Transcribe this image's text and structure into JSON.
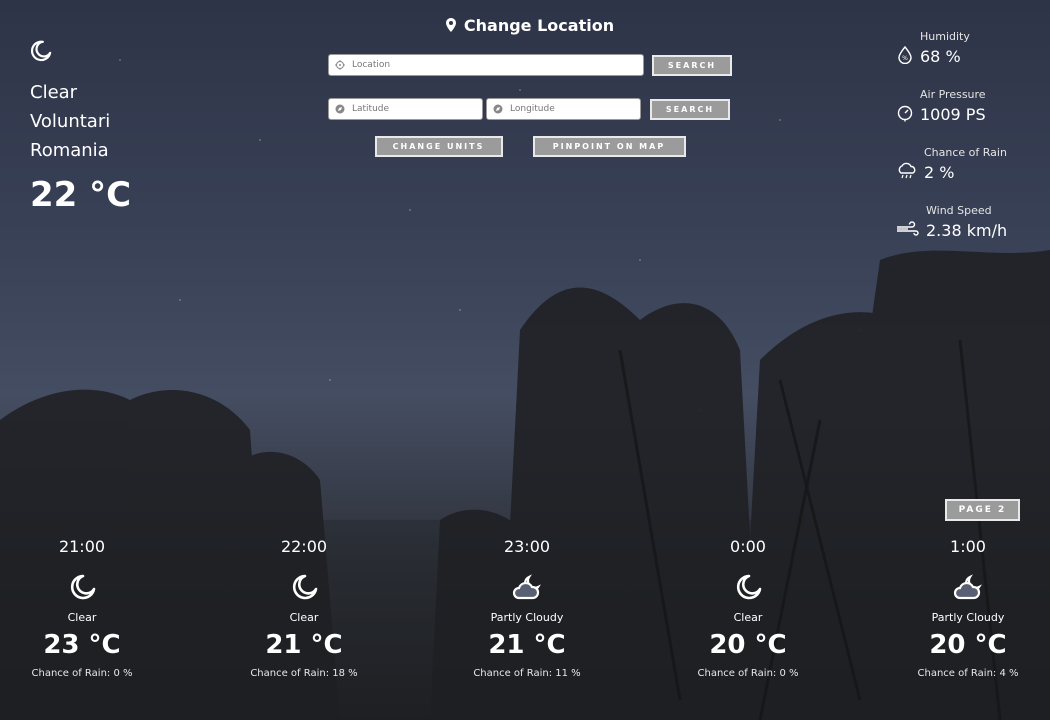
{
  "current": {
    "icon": "moon-icon",
    "condition": "Clear",
    "city": "Voluntari",
    "country": "Romania",
    "temperature": "22 °C"
  },
  "location_panel": {
    "title": "Change Location",
    "location_placeholder": "Location",
    "latitude_placeholder": "Latitude",
    "longitude_placeholder": "Longitude",
    "search_label": "SEARCH",
    "search_coords_label": "SEARCH",
    "change_units_label": "CHANGE UNITS",
    "pinpoint_label": "PINPOINT ON MAP"
  },
  "stats": {
    "humidity": {
      "label": "Humidity",
      "value": "68 %"
    },
    "air_pressure": {
      "label": "Air Pressure",
      "value": "1009 PS"
    },
    "chance_of_rain": {
      "label": "Chance of Rain",
      "value": "2 %"
    },
    "wind_speed": {
      "label": "Wind Speed",
      "value": "2.38 km/h"
    }
  },
  "page_button": "PAGE 2",
  "forecast": [
    {
      "time": "21:00",
      "icon": "moon-icon",
      "condition": "Clear",
      "temp": "23 °C",
      "rain": "Chance of Rain: 0 %"
    },
    {
      "time": "22:00",
      "icon": "moon-icon",
      "condition": "Clear",
      "temp": "21 °C",
      "rain": "Chance of Rain: 18 %"
    },
    {
      "time": "23:00",
      "icon": "cloud-moon-icon",
      "condition": "Partly Cloudy",
      "temp": "21 °C",
      "rain": "Chance of Rain: 11 %"
    },
    {
      "time": "0:00",
      "icon": "moon-icon",
      "condition": "Clear",
      "temp": "20 °C",
      "rain": "Chance of Rain: 0 %"
    },
    {
      "time": "1:00",
      "icon": "cloud-moon-icon",
      "condition": "Partly Cloudy",
      "temp": "20 °C",
      "rain": "Chance of Rain: 4 %"
    }
  ],
  "colors": {
    "button_bg": "#9b9b9b",
    "button_border": "#e9e9e9",
    "text": "#ffffff"
  }
}
